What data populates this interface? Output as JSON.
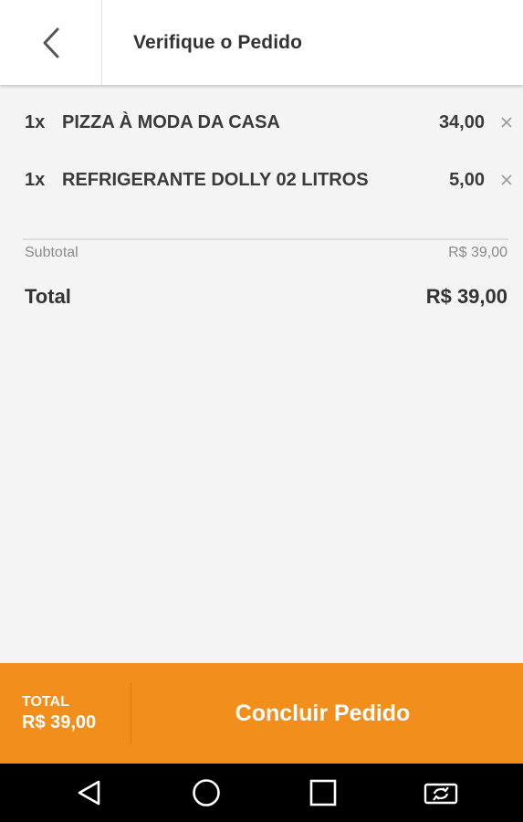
{
  "header": {
    "title": "Verifique o Pedido",
    "back_icon": "chevron-left-icon"
  },
  "order": {
    "items": [
      {
        "qty": "1x",
        "name": "PIZZA À MODA DA CASA",
        "price": "34,00",
        "remove_icon": "close-icon"
      },
      {
        "qty": "1x",
        "name": "REFRIGERANTE DOLLY 02 LITROS",
        "price": "5,00",
        "remove_icon": "close-icon"
      }
    ],
    "subtotal_label": "Subtotal",
    "subtotal_value": "R$ 39,00",
    "total_label": "Total",
    "total_value": "R$ 39,00"
  },
  "footer": {
    "total_label": "TOTAL",
    "total_value": "R$ 39,00",
    "conclude_label": "Concluir Pedido",
    "accent_color": "#f28e1c"
  },
  "system_nav": {
    "back_icon": "triangle-back-icon",
    "home_icon": "circle-home-icon",
    "recents_icon": "square-recents-icon",
    "extra_icon": "screen-rotate-icon"
  }
}
